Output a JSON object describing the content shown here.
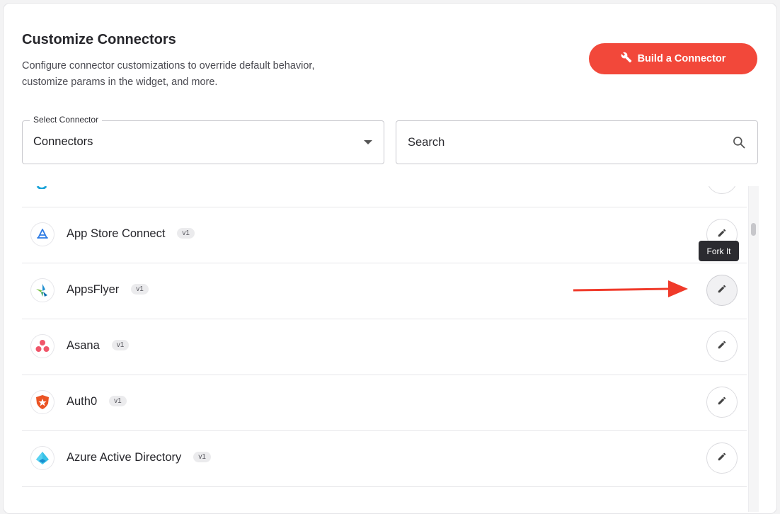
{
  "header": {
    "title": "Customize Connectors",
    "description": "Configure connector customizations to override default behavior, customize params in the widget, and more.",
    "build_button_label": "Build a Connector"
  },
  "filters": {
    "select_label": "Select Connector",
    "select_value": "Connectors",
    "search_placeholder": "Search"
  },
  "connectors": [
    {
      "name": "",
      "version": ""
    },
    {
      "name": "App Store Connect",
      "version": "v1"
    },
    {
      "name": "AppsFlyer",
      "version": "v1"
    },
    {
      "name": "Asana",
      "version": "v1"
    },
    {
      "name": "Auth0",
      "version": "v1"
    },
    {
      "name": "Azure Active Directory",
      "version": "v1"
    }
  ],
  "tooltip": {
    "label": "Fork It"
  },
  "colors": {
    "accent": "#f2483a",
    "annotation_arrow": "#f03a2a"
  }
}
